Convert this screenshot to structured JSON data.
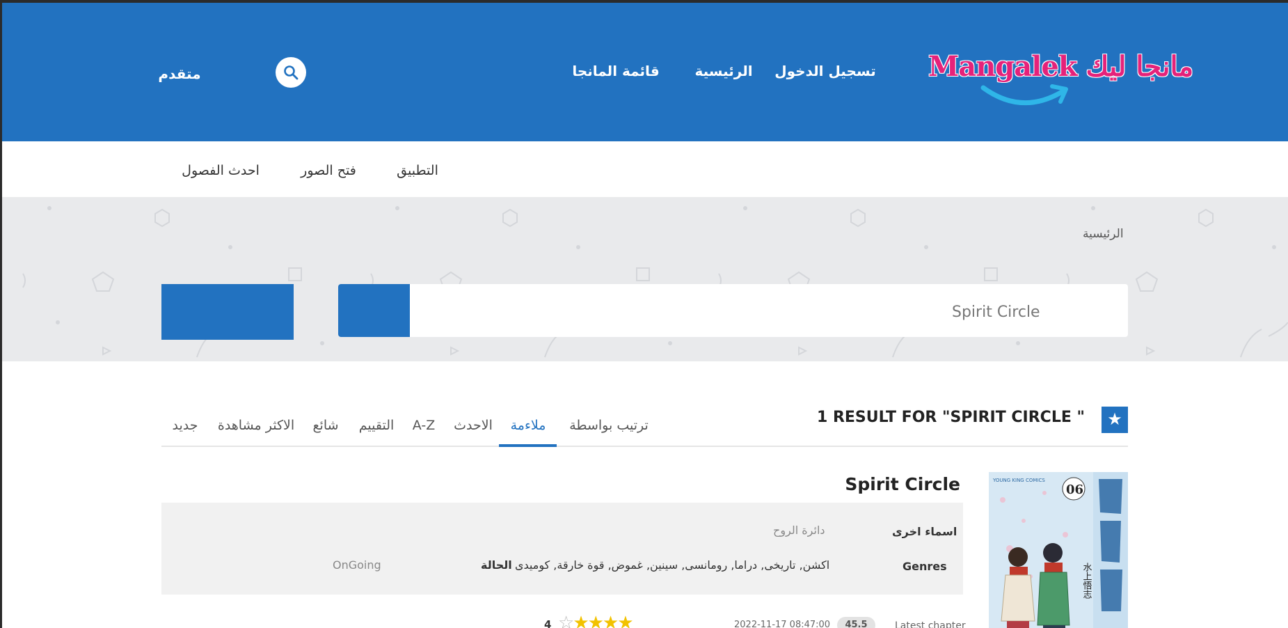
{
  "header": {
    "logo_text": "Mangalek مانجا ليك",
    "nav": {
      "login": "تسجيل الدخول",
      "home": "الرئيسية",
      "manga_list": "قائمة المانجا",
      "advanced": "متقدم"
    }
  },
  "subnav": {
    "app": "التطبيق",
    "open_images": "فتح الصور",
    "latest_chapters": "احدث الفصول"
  },
  "breadcrumb": "الرئيسية",
  "search": {
    "value": "Spirit Circle"
  },
  "results": {
    "title": "1 RESULT FOR \"SPIRIT CIRCLE \"",
    "sort_by": "ترتيب بواسطة",
    "tabs": [
      "ملاءمة",
      "الاحدث",
      "A-Z",
      "التقييم",
      "شائع",
      "الاكثر مشاهدة",
      "جديد"
    ],
    "active_tab": "ملاءمة"
  },
  "manga": {
    "title": "Spirit Circle",
    "other_names_label": "اسماء اخرى",
    "other_names": "دائرة الروح",
    "genres_label": "Genres",
    "genres": "اكشن, تاريخى, دراما, رومانسى, سينين, غموض, قوة خارقة, كوميدى",
    "status_label": "الحالة",
    "status": "OnGoing",
    "latest_chapter_label": "Latest chapter",
    "latest_chapter": "45.5",
    "date": "2022-11-17 08:47:00",
    "rating": "4",
    "stars_filled": 4,
    "stars_total": 5
  },
  "colors": {
    "brand_blue": "#2272c0",
    "logo_pink": "#e5227a",
    "star": "#f2c200"
  }
}
